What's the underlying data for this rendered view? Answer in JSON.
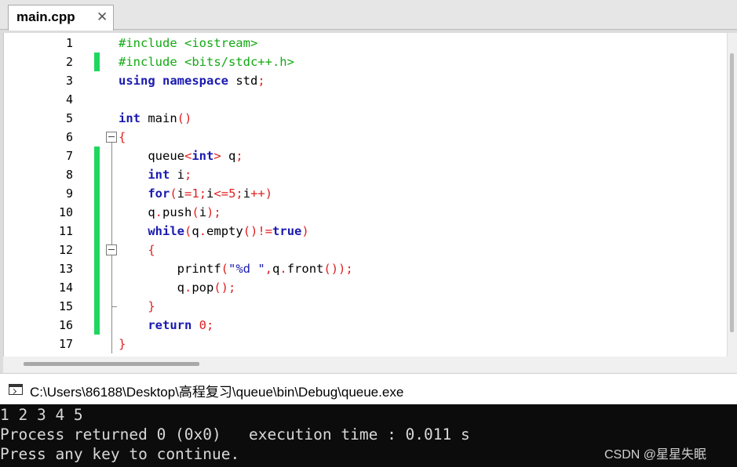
{
  "editor": {
    "tab_label": "main.cpp",
    "tab_close": "✕",
    "lines": [
      {
        "n": "1",
        "tokens": [
          {
            "c": "pp",
            "t": "#include <iostream>"
          }
        ]
      },
      {
        "n": "2",
        "tokens": [
          {
            "c": "pp",
            "t": "#include <bits/stdc++.h>"
          }
        ]
      },
      {
        "n": "3",
        "tokens": [
          {
            "c": "kw",
            "t": "using"
          },
          {
            "c": "id",
            "t": " "
          },
          {
            "c": "kw",
            "t": "namespace"
          },
          {
            "c": "id",
            "t": " std"
          },
          {
            "c": "op",
            "t": ";"
          }
        ]
      },
      {
        "n": "4",
        "tokens": []
      },
      {
        "n": "5",
        "tokens": [
          {
            "c": "kw",
            "t": "int"
          },
          {
            "c": "id",
            "t": " main"
          },
          {
            "c": "op",
            "t": "()"
          }
        ]
      },
      {
        "n": "6",
        "tokens": [
          {
            "c": "op",
            "t": "{"
          }
        ]
      },
      {
        "n": "7",
        "tokens": [
          {
            "c": "id",
            "t": "    queue"
          },
          {
            "c": "op",
            "t": "<"
          },
          {
            "c": "kw",
            "t": "int"
          },
          {
            "c": "op",
            "t": ">"
          },
          {
            "c": "id",
            "t": " q"
          },
          {
            "c": "op",
            "t": ";"
          }
        ]
      },
      {
        "n": "8",
        "tokens": [
          {
            "c": "id",
            "t": "    "
          },
          {
            "c": "kw",
            "t": "int"
          },
          {
            "c": "id",
            "t": " i"
          },
          {
            "c": "op",
            "t": ";"
          }
        ]
      },
      {
        "n": "9",
        "tokens": [
          {
            "c": "id",
            "t": "    "
          },
          {
            "c": "kw",
            "t": "for"
          },
          {
            "c": "op",
            "t": "("
          },
          {
            "c": "id",
            "t": "i"
          },
          {
            "c": "op",
            "t": "="
          },
          {
            "c": "num",
            "t": "1"
          },
          {
            "c": "op",
            "t": ";"
          },
          {
            "c": "id",
            "t": "i"
          },
          {
            "c": "op",
            "t": "<="
          },
          {
            "c": "num",
            "t": "5"
          },
          {
            "c": "op",
            "t": ";"
          },
          {
            "c": "id",
            "t": "i"
          },
          {
            "c": "op",
            "t": "++)"
          }
        ]
      },
      {
        "n": "10",
        "tokens": [
          {
            "c": "id",
            "t": "    q"
          },
          {
            "c": "op",
            "t": "."
          },
          {
            "c": "id",
            "t": "push"
          },
          {
            "c": "op",
            "t": "("
          },
          {
            "c": "id",
            "t": "i"
          },
          {
            "c": "op",
            "t": ");"
          }
        ]
      },
      {
        "n": "11",
        "tokens": [
          {
            "c": "id",
            "t": "    "
          },
          {
            "c": "kw",
            "t": "while"
          },
          {
            "c": "op",
            "t": "("
          },
          {
            "c": "id",
            "t": "q"
          },
          {
            "c": "op",
            "t": "."
          },
          {
            "c": "id",
            "t": "empty"
          },
          {
            "c": "op",
            "t": "()!="
          },
          {
            "c": "kw",
            "t": "true"
          },
          {
            "c": "op",
            "t": ")"
          }
        ]
      },
      {
        "n": "12",
        "tokens": [
          {
            "c": "id",
            "t": "    "
          },
          {
            "c": "op",
            "t": "{"
          }
        ]
      },
      {
        "n": "13",
        "tokens": [
          {
            "c": "id",
            "t": "        printf"
          },
          {
            "c": "op",
            "t": "("
          },
          {
            "c": "str",
            "t": "\"%d \""
          },
          {
            "c": "op",
            "t": ","
          },
          {
            "c": "id",
            "t": "q"
          },
          {
            "c": "op",
            "t": "."
          },
          {
            "c": "id",
            "t": "front"
          },
          {
            "c": "op",
            "t": "());"
          }
        ]
      },
      {
        "n": "14",
        "tokens": [
          {
            "c": "id",
            "t": "        q"
          },
          {
            "c": "op",
            "t": "."
          },
          {
            "c": "id",
            "t": "pop"
          },
          {
            "c": "op",
            "t": "();"
          }
        ]
      },
      {
        "n": "15",
        "tokens": [
          {
            "c": "id",
            "t": "    "
          },
          {
            "c": "op",
            "t": "}"
          }
        ]
      },
      {
        "n": "16",
        "tokens": [
          {
            "c": "id",
            "t": "    "
          },
          {
            "c": "kw",
            "t": "return"
          },
          {
            "c": "id",
            "t": " "
          },
          {
            "c": "num",
            "t": "0"
          },
          {
            "c": "op",
            "t": ";"
          }
        ]
      },
      {
        "n": "17",
        "tokens": [
          {
            "c": "op",
            "t": "}"
          }
        ]
      }
    ],
    "changed_lines": [
      "2",
      "7",
      "8",
      "9",
      "10",
      "11",
      "12",
      "13",
      "14",
      "15",
      "16"
    ]
  },
  "console": {
    "title": "C:\\Users\\86188\\Desktop\\高程复习\\queue\\bin\\Debug\\queue.exe",
    "output": [
      "1 2 3 4 5",
      "Process returned 0 (0x0)   execution time : 0.011 s",
      "Press any key to continue."
    ],
    "watermark": "CSDN @星星失眠"
  },
  "colors": {
    "preprocessor": "#13a813",
    "keyword": "#1a1ab0",
    "operator": "#e02020",
    "change_marker": "#1ed760",
    "console_bg": "#0c0c0c"
  }
}
